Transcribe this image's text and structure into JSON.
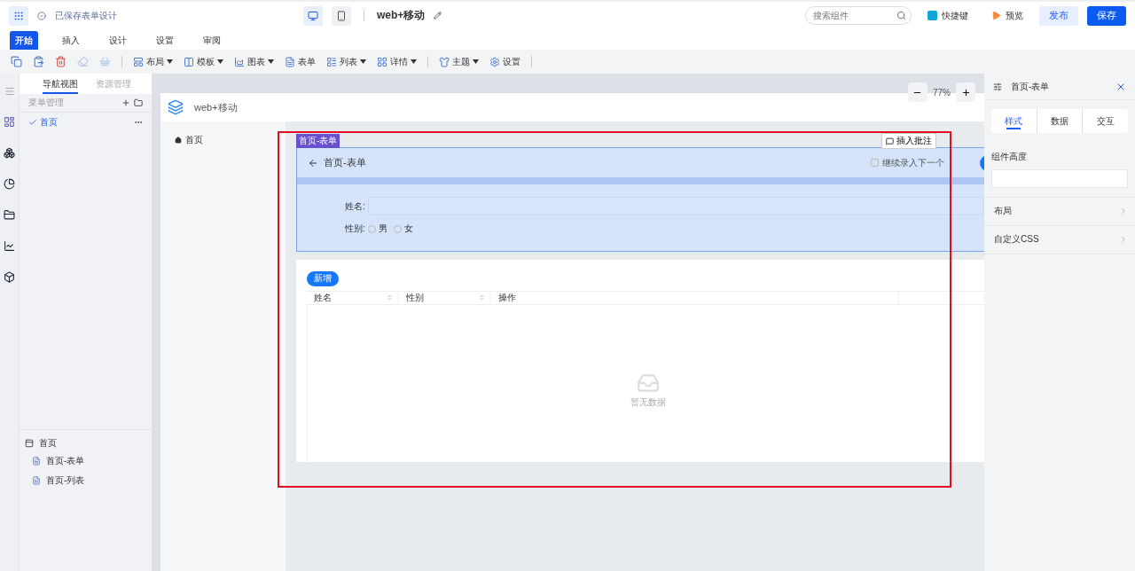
{
  "top_bar": {
    "save_status": "已保存表单设计",
    "devices": [
      {
        "kind": "desktop",
        "selected": true
      },
      {
        "kind": "mobile",
        "selected": false
      }
    ],
    "title": "web+移动",
    "search": {
      "placeholder": "搜索组件"
    },
    "links": [
      {
        "kind": "shortcut",
        "label": "快捷键"
      },
      {
        "kind": "preview",
        "label": "预览"
      }
    ],
    "buttons": [
      {
        "kind": "secondary",
        "label": "发布"
      },
      {
        "kind": "primary",
        "label": "保存"
      }
    ]
  },
  "menu_tabs": [
    {
      "label": "开始",
      "selected": true
    },
    {
      "label": "插入",
      "selected": false
    },
    {
      "label": "设计",
      "selected": false
    },
    {
      "label": "设置",
      "selected": false
    },
    {
      "label": "审阅",
      "selected": false
    }
  ],
  "toolbar": [
    {
      "kind": "icon",
      "disabled": false
    },
    {
      "kind": "icon",
      "disabled": false
    },
    {
      "kind": "icon",
      "disabled": false
    },
    {
      "kind": "icon",
      "disabled": true
    },
    {
      "kind": "icon",
      "disabled": true
    },
    {
      "kind": "separator"
    },
    {
      "kind": "dropdown",
      "label": "布局"
    },
    {
      "kind": "dropdown",
      "label": "模板"
    },
    {
      "kind": "dropdown",
      "label": "图表"
    },
    {
      "kind": "button",
      "label": "表单"
    },
    {
      "kind": "dropdown",
      "label": "列表"
    },
    {
      "kind": "dropdown",
      "label": "详情"
    },
    {
      "kind": "separator"
    },
    {
      "kind": "dropdown",
      "label": "主题"
    },
    {
      "kind": "button",
      "label": "设置"
    },
    {
      "kind": "separator"
    }
  ],
  "nav_panel": {
    "tabs": [
      {
        "label": "导航视图",
        "selected": true
      },
      {
        "label": "资源管理",
        "selected": false
      }
    ],
    "section": "菜单管理",
    "items": [
      {
        "label": "首页",
        "selected": true
      }
    ],
    "tree": [
      {
        "label": "首页",
        "children": [
          {
            "label": "首页-表单"
          },
          {
            "label": "首页-列表"
          }
        ]
      }
    ]
  },
  "canvas": {
    "zoom": "77%",
    "app_title": "web+移动",
    "menu": [
      {
        "label": "首页"
      }
    ],
    "selection_tag": "首页-表单",
    "comment_button": "插入批注",
    "form": {
      "title": "首页-表单",
      "continue": {
        "label": "继续录入下一个",
        "checked": false
      },
      "fields": [
        {
          "kind": "text",
          "label": "姓名:"
        },
        {
          "kind": "radio",
          "label": "性别:",
          "options": [
            {
              "label": "男",
              "selected": false
            },
            {
              "label": "女",
              "selected": false
            }
          ]
        }
      ]
    },
    "table": {
      "add_button": "新增",
      "columns": [
        {
          "label": "姓名",
          "sortable": true
        },
        {
          "label": "性别",
          "sortable": true
        },
        {
          "label": "操作",
          "sortable": false
        }
      ],
      "empty_text": "暂无数据"
    }
  },
  "right_panel": {
    "title": "首页-表单",
    "tabs": [
      {
        "label": "样式",
        "selected": true
      },
      {
        "label": "数据",
        "selected": false
      },
      {
        "label": "交互",
        "selected": false
      }
    ],
    "fields": [
      {
        "kind": "input",
        "label": "组件高度"
      },
      {
        "kind": "section",
        "label": "布局"
      },
      {
        "kind": "section",
        "label": "自定义CSS"
      }
    ]
  }
}
